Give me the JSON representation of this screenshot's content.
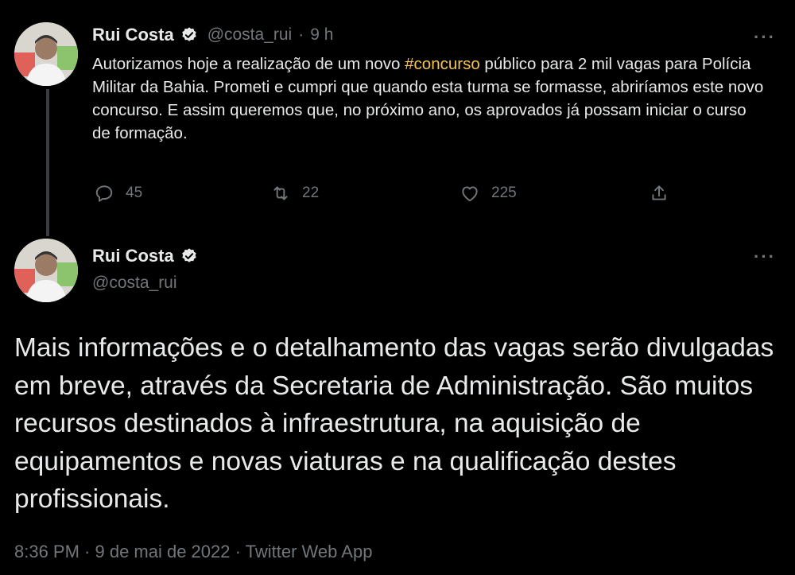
{
  "parent_tweet": {
    "author_name": "Rui Costa",
    "handle": "@costa_rui",
    "separator": "·",
    "time": "9 h",
    "more_label": "···",
    "text_before": "Autorizamos hoje a realização de um novo ",
    "hashtag": "#concurso",
    "text_after": " público para 2 mil vagas para Polícia Militar da Bahia. Prometi e cumpri que quando esta turma se formasse, abriríamos este novo concurso. E assim queremos que, no próximo ano, os aprovados já possam iniciar o curso de formação.",
    "replies": "45",
    "retweets": "22",
    "likes": "225",
    "icons": [
      "reply-icon",
      "retweet-icon",
      "like-icon",
      "share-icon"
    ]
  },
  "main_tweet": {
    "author_name": "Rui Costa",
    "handle": "@costa_rui",
    "more_label": "···",
    "text": "Mais informações e o detalhamento das vagas serão divulgadas em breve, através da Secretaria de Administração. São muitos recursos destinados à infraestrutura, na aquisição de equipamentos e novas viaturas e na qualificação destes profissionais.",
    "meta": "8:36 PM · 9 de mai de 2022 · Twitter Web App"
  },
  "colors": {
    "background": "#000000",
    "text": "#e7e9ea",
    "muted": "#71767b",
    "hashtag": "#f4c34f",
    "verified_badge": "#e7e9ea"
  }
}
